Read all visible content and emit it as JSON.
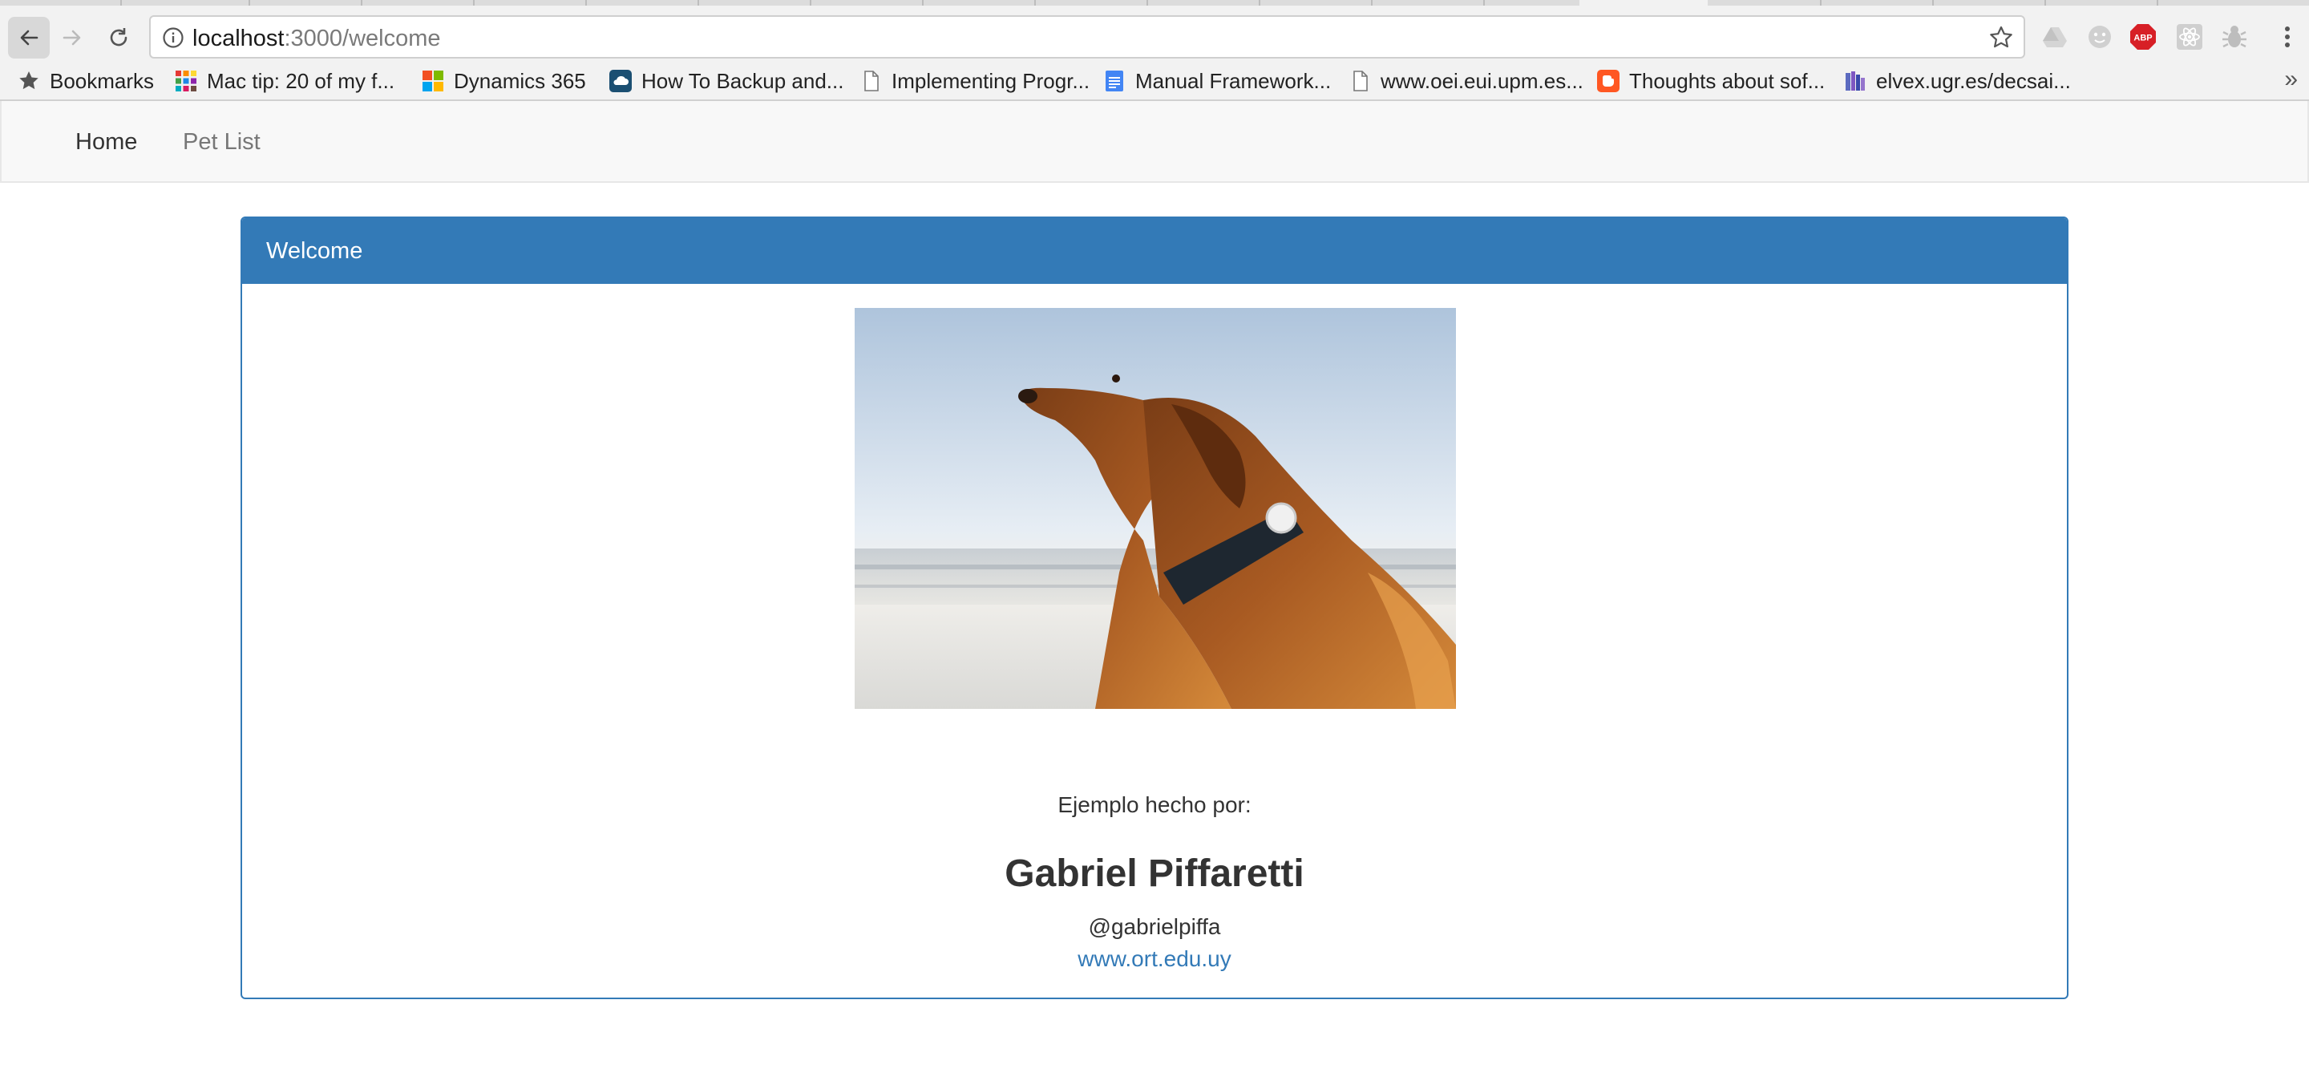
{
  "browser": {
    "url_host": "localhost",
    "url_path": ":3000/welcome",
    "bookmarks": [
      {
        "label": "Bookmarks",
        "icon": "star-icon"
      },
      {
        "label": "Mac tip: 20 of my f...",
        "icon": "grid-icon"
      },
      {
        "label": "Dynamics 365",
        "icon": "microsoft-logo-icon"
      },
      {
        "label": "How To Backup and...",
        "icon": "cloud-icon"
      },
      {
        "label": "Implementing Progr...",
        "icon": "page-icon"
      },
      {
        "label": "Manual Framework...",
        "icon": "google-docs-icon"
      },
      {
        "label": "www.oei.eui.upm.es...",
        "icon": "page-icon"
      },
      {
        "label": "Thoughts about sof...",
        "icon": "blogger-icon"
      },
      {
        "label": "elvex.ugr.es/decsai...",
        "icon": "books-icon"
      }
    ],
    "bookmarks_overflow": "»",
    "extensions": {
      "abp_label": "ABP"
    }
  },
  "navbar": {
    "home_label": "Home",
    "pet_list_label": "Pet List"
  },
  "panel": {
    "title": "Welcome",
    "credit_label": "Ejemplo hecho por:",
    "author_name": "Gabriel Piffaretti",
    "author_handle": "@gabrielpiffa",
    "author_link": "www.ort.edu.uy"
  },
  "colors": {
    "primary": "#337ab7",
    "navbar_bg": "#f8f8f8",
    "chrome_bg": "#f2f2f2",
    "abp_red": "#d71f26"
  }
}
